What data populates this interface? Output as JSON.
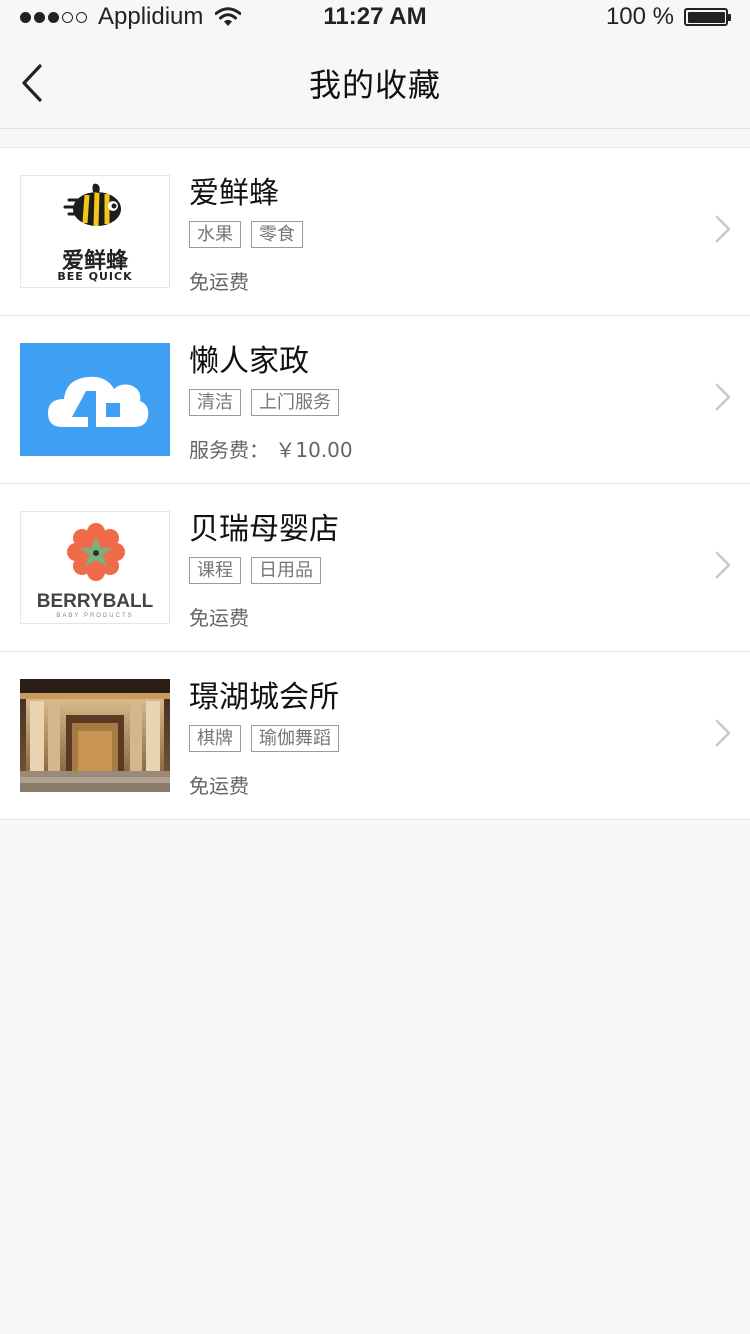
{
  "status_bar": {
    "signal_full": 3,
    "signal_empty": 2,
    "carrier": "Applidium",
    "time": "11:27 AM",
    "battery_text": "100 %",
    "battery_level": 1.0
  },
  "nav": {
    "title": "我的收藏",
    "back_icon": "chevron-left-icon"
  },
  "favorites": [
    {
      "name": "爱鲜蜂",
      "tags": [
        "水果",
        "零食"
      ],
      "fee": "免运费",
      "logo_text": "爱鲜蜂",
      "logo_subtext": "BEE QUICK"
    },
    {
      "name": "懒人家政",
      "tags": [
        "清洁",
        "上门服务"
      ],
      "fee": "服务费： ￥10.00",
      "logo_color": "#3f9ff3"
    },
    {
      "name": "贝瑞母婴店",
      "tags": [
        "课程",
        "日用品"
      ],
      "fee": "免运费",
      "logo_text": "BERRYBALL",
      "logo_subtext": "BABY PRODUCTS"
    },
    {
      "name": "璟湖城会所",
      "tags": [
        "棋牌",
        "瑜伽舞蹈"
      ],
      "fee": "免运费"
    }
  ],
  "colors": {
    "background": "#f7f7f7",
    "separator": "#e6e6e6",
    "tag_border": "#9a9a9a",
    "chevron": "#c7c7cc"
  }
}
